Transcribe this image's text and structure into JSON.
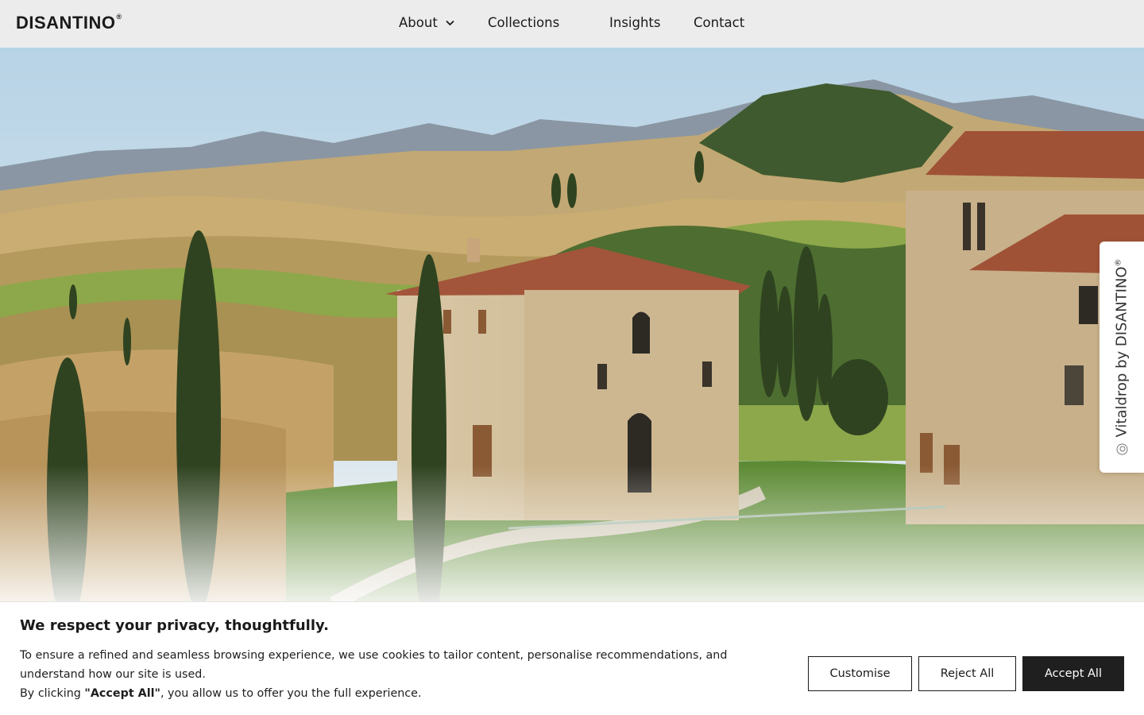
{
  "header": {
    "logo_text": "DISANTINO",
    "logo_mark": "®",
    "nav": {
      "about": "About",
      "collections": "Collections",
      "insights": "Insights",
      "contact": "Contact"
    }
  },
  "hero": {
    "description": "Tuscan countryside with stone villa, cypress trees and rolling hills"
  },
  "side_tab": {
    "label": "Vitaldrop by DISANTINO",
    "mark": "®",
    "icon": "circle-target-icon"
  },
  "cookie_banner": {
    "title": "We respect your privacy, thoughtfully.",
    "line1": "To ensure a refined and seamless browsing experience, we use cookies to tailor content, personalise recommendations, and understand how our site is used.",
    "line2_prefix": "By clicking ",
    "line2_bold": "\"Accept All\"",
    "line2_suffix": ", you allow us to offer you the full experience.",
    "buttons": {
      "customise": "Customise",
      "reject": "Reject All",
      "accept": "Accept All"
    }
  },
  "colors": {
    "header_bg": "#ececec",
    "accent_dark": "#1f1f1f"
  }
}
